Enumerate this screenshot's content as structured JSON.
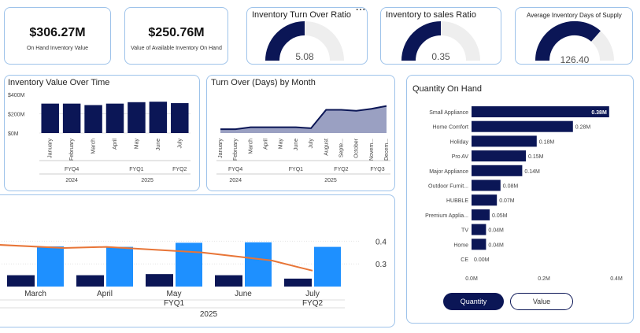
{
  "kpis": [
    {
      "value": "$306.27M",
      "label": "On Hand Inventory Value"
    },
    {
      "value": "$250.76M",
      "label": "Value of Available Inventory On Hand"
    }
  ],
  "gauges": [
    {
      "title": "Inventory Turn Over Ratio",
      "value": "5.08",
      "fraction": 0.5
    },
    {
      "title": "Inventory to sales Ratio",
      "value": "0.35",
      "fraction": 0.5
    },
    {
      "title": "Average Inventory Days of Supply",
      "value": "126.40",
      "fraction": 0.72
    }
  ],
  "more_options": "...",
  "colors": {
    "navy": "#0b1656",
    "blue": "#1e90ff",
    "orange": "#e87537",
    "area": "#9aa0c2",
    "border": "#9ec3ea"
  },
  "inventory_value_chart": {
    "title": "Inventory Value Over Time",
    "y_ticks": [
      "$400M",
      "$200M",
      "$0M"
    ],
    "quarters": [
      "FYQ4",
      "FYQ1",
      "FYQ2"
    ],
    "years": [
      "2024",
      "2025"
    ]
  },
  "turnover_chart": {
    "title": "Turn Over (Days) by Month",
    "quarters": [
      "FYQ4",
      "FYQ1",
      "FYQ2",
      "FYQ3"
    ],
    "years": [
      "2024",
      "2025"
    ]
  },
  "qoh_chart": {
    "title": "Quantity On Hand",
    "x_ticks": [
      "0.0M",
      "0.2M",
      "0.4M"
    ],
    "buttons": {
      "quantity": "Quantity",
      "value": "Value"
    }
  },
  "combo_chart": {
    "right_ticks": [
      "0.4",
      "0.3"
    ],
    "quarters": [
      "FYQ1",
      "FYQ2"
    ],
    "year": "2025"
  },
  "chart_data": [
    {
      "type": "bar",
      "title": "Inventory Value Over Time",
      "categories": [
        "January",
        "February",
        "March",
        "April",
        "May",
        "June",
        "July"
      ],
      "values": [
        305,
        305,
        290,
        305,
        320,
        325,
        310
      ],
      "ylim": [
        0,
        400
      ],
      "ylabel": "",
      "xlabel": ""
    },
    {
      "type": "area",
      "title": "Turn Over (Days) by Month",
      "categories": [
        "January",
        "February",
        "March",
        "April",
        "May",
        "June",
        "July",
        "August",
        "Septe...",
        "October",
        "Novem...",
        "Decem..."
      ],
      "values": [
        8,
        8,
        12,
        12,
        12,
        12,
        10,
        48,
        48,
        46,
        50,
        56
      ],
      "ylim": [
        0,
        70
      ]
    },
    {
      "type": "bar",
      "orientation": "horizontal",
      "title": "Quantity On Hand",
      "categories": [
        "Small Appliance",
        "Home Comfort",
        "Holiday",
        "Pro AV",
        "Major Appliance",
        "Outdoor Furnit...",
        "HUBBLE",
        "Premium Applia...",
        "TV",
        "Home",
        "CE"
      ],
      "values": [
        0.38,
        0.28,
        0.18,
        0.15,
        0.14,
        0.08,
        0.07,
        0.05,
        0.04,
        0.04,
        0.0
      ],
      "labels": [
        "0.38M",
        "0.28M",
        "0.18M",
        "0.15M",
        "0.14M",
        "0.08M",
        "0.07M",
        "0.05M",
        "0.04M",
        "0.04M",
        "0.00M"
      ],
      "xlim": [
        0,
        0.4
      ]
    },
    {
      "type": "bar",
      "title": "",
      "categories": [
        "March",
        "April",
        "May",
        "June",
        "July"
      ],
      "series": [
        {
          "values": [
            0.25,
            0.25,
            0.255,
            0.25,
            0.235
          ]
        },
        {
          "values": [
            0.377,
            0.375,
            0.393,
            0.395,
            0.375
          ]
        },
        {
          "values": [
            0.385,
            0.375,
            0.35,
            0.315,
            0.27
          ]
        }
      ],
      "ylim": [
        0.2,
        0.45
      ]
    }
  ]
}
